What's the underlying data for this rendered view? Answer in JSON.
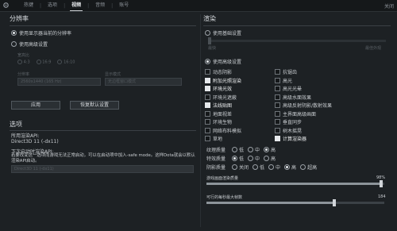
{
  "tabs": [
    {
      "label": "热键",
      "active": false
    },
    {
      "label": "选项",
      "active": false
    },
    {
      "label": "视频",
      "active": true
    },
    {
      "label": "音频",
      "active": false
    },
    {
      "label": "账号",
      "active": false
    }
  ],
  "close_label": "关闭",
  "left": {
    "resolution_title": "分辨率",
    "use_display_res": "使用显示器当前的分辨率",
    "use_advanced": "使用高级设置",
    "aspect_label": "宽高比",
    "aspect_options": [
      "4:3",
      "16:9",
      "16:10"
    ],
    "resolution_label": "分辨率",
    "resolution_value": "2560x1440 (165 Hz)",
    "display_mode_label": "显示模式",
    "display_mode_value": "无边框窗口模式",
    "apply_button": "应用",
    "restore_button": "恢复默认设置",
    "options_title": "选项",
    "render_api_label": "所用渲染API:",
    "render_api_value": "Direct3D 11 (-dx11)",
    "next_api_label": "下次启动时渲染API:",
    "next_api_desc": "若要改变这一选项而游戏无法正常启动，可以在启动项中加入-safe mode。这样Dota就会以默认渲染API启动。",
    "next_api_select": "Direct3D 11 (-dx11)"
  },
  "right": {
    "render_title": "渲染",
    "use_basic": "使用基础设置",
    "slider_fastest": "最快",
    "slider_best": "最佳外观",
    "use_advanced": "使用高级设置",
    "checkboxes_left": [
      {
        "label": "动态阴影",
        "checked": false
      },
      {
        "label": "附加光照渲染",
        "checked": true
      },
      {
        "label": "环境光效",
        "checked": true
      },
      {
        "label": "环境光遮蔽",
        "checked": false
      },
      {
        "label": "法线贴图",
        "checked": true
      },
      {
        "label": "地面视差",
        "checked": false
      },
      {
        "label": "环境生物",
        "checked": false
      },
      {
        "label": "网络布料模拟",
        "checked": false
      },
      {
        "label": "草地",
        "checked": false
      }
    ],
    "checkboxes_right": [
      {
        "label": "抗锯齿",
        "checked": false
      },
      {
        "label": "高光",
        "checked": false
      },
      {
        "label": "高光光晕",
        "checked": false
      },
      {
        "label": "高级水面效果",
        "checked": false
      },
      {
        "label": "高级反射阴影/散射效果",
        "checked": false
      },
      {
        "label": "主界面高级画面",
        "checked": false
      },
      {
        "label": "垂直同步",
        "checked": false
      },
      {
        "label": "树木摇晃",
        "checked": false
      },
      {
        "label": "计算渲染器",
        "checked": true
      }
    ],
    "texture_quality_label": "纹理质量",
    "effects_quality_label": "特效质量",
    "shadow_quality_label": "阴影质量",
    "q_low": "低",
    "q_mid": "中",
    "q_high": "高",
    "q_off": "关闭",
    "q_ultra": "超高",
    "texture_selected": "高",
    "effects_selected": "低",
    "shadow_selected": "高",
    "screen_render_label": "游戏画面渲染质量",
    "screen_render_value": "98%",
    "screen_render_fraction": 0.98,
    "max_fps_label": "可行的每秒最大帧数",
    "max_fps_value": "184",
    "max_fps_fraction": 0.72
  }
}
